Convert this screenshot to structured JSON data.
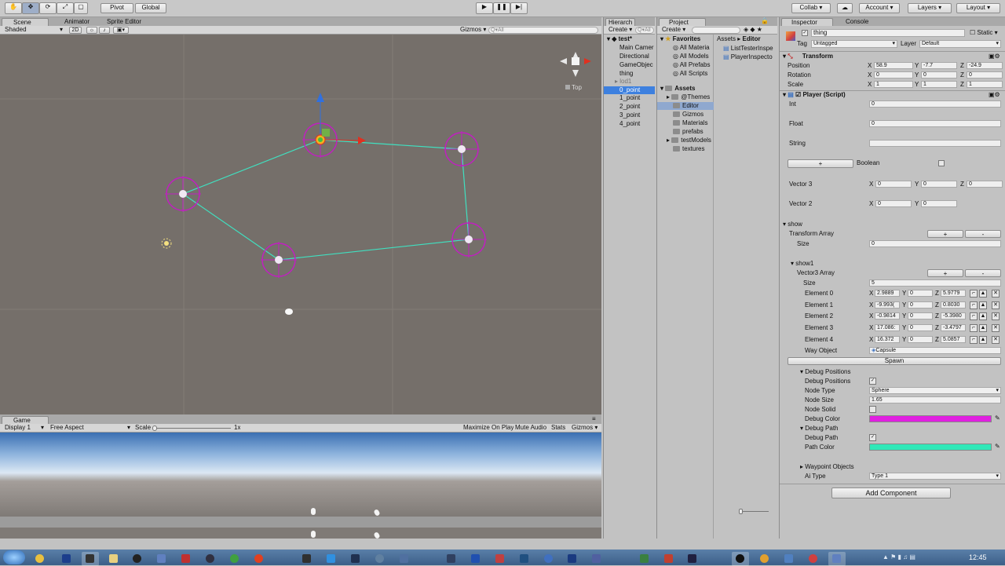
{
  "toolbar": {
    "pivot": "Pivot",
    "global": "Global",
    "collab": "Collab ▾",
    "account": "Account",
    "layers": "Layers",
    "layout": "Layout"
  },
  "scene": {
    "tabs": {
      "scene": "Scene",
      "animator": "Animator",
      "sprite_editor": "Sprite Editor"
    },
    "shading": "Shaded",
    "mode_2d": "2D",
    "gizmos": "Gizmos ▾",
    "search_placeholder": "Q▾All",
    "view_label": "Top",
    "waypoint_color": "#c020c0",
    "path_color": "#40e0c0"
  },
  "game": {
    "tab": "Game",
    "display": "Display 1",
    "aspect": "Free Aspect",
    "scale_label": "Scale",
    "scale_value": "1x",
    "maximize": "Maximize On Play",
    "mute": "Mute Audio",
    "stats": "Stats",
    "gizmos": "Gizmos"
  },
  "hierarchy": {
    "tab": "Hierarch",
    "create": "Create ▾",
    "search_placeholder": "Q▾All",
    "scene_name": "test*",
    "items": [
      "Main Camer",
      "Directional",
      "GameObjec",
      "thing",
      "lod1",
      "0_point",
      "1_point",
      "2_point",
      "3_point",
      "4_point"
    ],
    "selected_index": 5
  },
  "project": {
    "tab": "Project",
    "create": "Create ▾",
    "favorites_title": "Favorites",
    "favorites": [
      "All Materia",
      "All Models",
      "All Prefabs",
      "All Scripts"
    ],
    "assets_title": "Assets",
    "folders": [
      "@Themes",
      "Editor",
      "Gizmos",
      "Materials",
      "prefabs",
      "testModels",
      "textures"
    ],
    "selected_folder_index": 1,
    "breadcrumb": [
      "Assets",
      "Editor"
    ],
    "files": [
      "ListTesterInspe",
      "PlayerInspecto"
    ]
  },
  "inspector": {
    "tabs": {
      "inspector": "Inspector",
      "console": "Console"
    },
    "object_name": "thing",
    "static_label": "Static ▾",
    "tag_label": "Tag",
    "tag_value": "Untagged",
    "layer_label": "Layer",
    "layer_value": "Default",
    "transform": {
      "title": "Transform",
      "rows": [
        {
          "label": "Position",
          "x": "58.9",
          "y": "-7.7",
          "z": "-24.9"
        },
        {
          "label": "Rotation",
          "x": "0",
          "y": "0",
          "z": "0"
        },
        {
          "label": "Scale",
          "x": "1",
          "y": "1",
          "z": "1"
        }
      ]
    },
    "player": {
      "title": "Player (Script)",
      "int_label": "Int",
      "int_value": "0",
      "float_label": "Float",
      "float_value": "0",
      "string_label": "String",
      "string_value": "",
      "plus": "+",
      "boolean_label": "Boolean",
      "v3_label": "Vector 3",
      "v3": {
        "x": "0",
        "y": "0",
        "z": "0"
      },
      "v2_label": "Vector 2",
      "v2": {
        "x": "0",
        "y": "0"
      },
      "show": "show",
      "transform_array": "Transform Array",
      "size_label": "Size",
      "transform_size": "0",
      "show1": "show1",
      "vector3_array": "Vector3 Array",
      "v3_size": "5",
      "elements": [
        {
          "label": "Element 0",
          "x": "2.9889",
          "y": "0",
          "z": "5.9779"
        },
        {
          "label": "Element 1",
          "x": "-9.993(",
          "y": "0",
          "z": "0.8030"
        },
        {
          "label": "Element 2",
          "x": "-0.9814",
          "y": "0",
          "z": "-5.3980"
        },
        {
          "label": "Element 3",
          "x": "17.086:",
          "y": "0",
          "z": "-3.4797"
        },
        {
          "label": "Element 4",
          "x": "16.372",
          "y": "0",
          "z": "5.0857"
        }
      ],
      "way_object_label": "Way Object",
      "way_object_value": "Capsule",
      "spawn": "Spawn",
      "debug_positions_header": "Debug Positions",
      "debug_positions": "Debug Positions",
      "node_type_label": "Node Type",
      "node_type_value": "Sphere",
      "node_size_label": "Node Size",
      "node_size_value": "1.65",
      "node_solid_label": "Node Solid",
      "debug_color_label": "Debug Color",
      "debug_color": "#e020e0",
      "debug_path_header": "Debug Path",
      "debug_path": "Debug Path",
      "path_color_label": "Path Color",
      "path_color": "#30e8b8",
      "waypoint_objects": "Waypoint Objects",
      "ai_type_label": "Ai Type",
      "ai_type_value": "Type 1"
    },
    "add_component": "Add Component"
  },
  "taskbar": {
    "time": "12:45"
  }
}
